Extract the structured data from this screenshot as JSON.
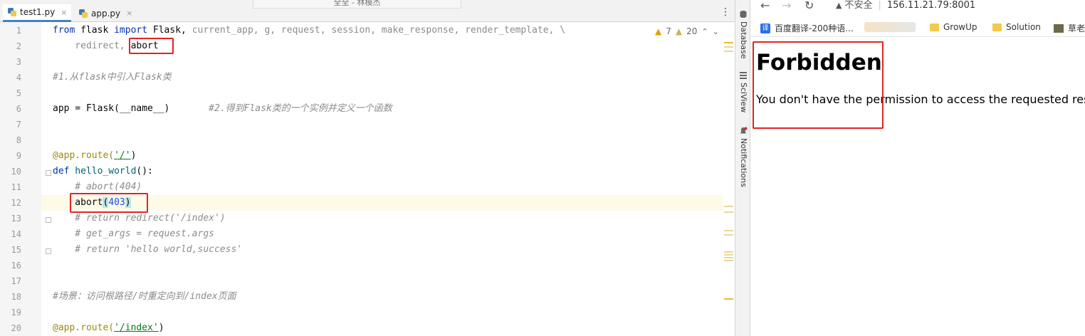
{
  "ide": {
    "title_popup": "全全 - 林模杰",
    "tabs": [
      {
        "label": "test1.py",
        "close": "×"
      },
      {
        "label": "app.py",
        "close": "×"
      }
    ],
    "menu_glyph": "⋮",
    "inspections": {
      "warnings": "7",
      "weak_warnings": "20",
      "warn_glyph": "▲",
      "up": "⌃",
      "down": "⌄"
    },
    "line_numbers": [
      "1",
      "2",
      "3",
      "4",
      "5",
      "6",
      "7",
      "8",
      "9",
      "10",
      "11",
      "12",
      "13",
      "14",
      "15",
      "16",
      "17",
      "18",
      "19",
      "20"
    ],
    "code": {
      "l1_a": "from",
      "l1_b": " flask ",
      "l1_c": "import",
      "l1_d": " Flask, ",
      "l1_e": "current_app, g, request, session, make_response, render_template, \\",
      "l2_a": "    redirect, ",
      "l2_b": "abort",
      "l4": "#1.从flask中引入Flask类",
      "l6_a": "app = Flask(__name__)",
      "l6_b": "       #2.得到Flask类的一个实例并定义一个函数",
      "l9_a": "@app.route(",
      "l9_b": "'/'",
      "l9_c": ")",
      "l10_a": "def",
      "l10_b": " hello_world",
      "l10_c": "():",
      "l11": "    # abort(404)",
      "l12_a": "    abort",
      "l12_b": "(",
      "l12_c": "403",
      "l12_d": ")",
      "l13": "    # return redirect('/index')",
      "l14": "    # get_args = request.args",
      "l15": "    # return 'hello world,success'",
      "l18": "#场景：访问根路径/时重定向到/index页面",
      "l20_a": "@app.route(",
      "l20_b": "'/index'",
      "l20_c": ")"
    }
  },
  "toolstrip": {
    "database": "Database",
    "sciview": "SciView",
    "notifications": "Notifications"
  },
  "browser": {
    "back": "←",
    "forward": "→",
    "reload": "↻",
    "security_icon": "▲",
    "security_label": "不安全",
    "url": "156.11.21.79:8001",
    "bookmarks": {
      "translate": "百度翻译-200种语...",
      "translate_icon": "译",
      "growup": "GrowUp",
      "solution": "Solution",
      "last": "草老"
    },
    "page": {
      "heading": "Forbidden",
      "message": "You don't have the permission to access the requested resource. It is either read-protected or not readable by the server."
    }
  },
  "colors": {
    "highlight_box": "#e02424",
    "keyword": "#0033b3",
    "comment": "#8c8c8c",
    "decorator": "#9e880d",
    "string": "#067d17",
    "number": "#1750eb"
  }
}
